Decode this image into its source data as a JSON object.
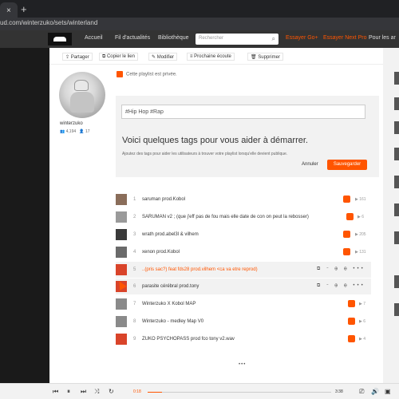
{
  "browser": {
    "tab_close": "×",
    "new_tab": "+",
    "url": "ud.com/winterzuko/sets/winterland"
  },
  "header": {
    "nav": [
      "Accueil",
      "Fil d'actualités",
      "Bibliothèque"
    ],
    "search_placeholder": "Rechercher",
    "try_go": "Essayer Go+",
    "try_pro": "Essayer Next Pro",
    "for_artists": "Pour les ar"
  },
  "actions": [
    "Partager",
    "Copier le lien",
    "Modifier",
    "Prochaine écoute",
    "Supprimer"
  ],
  "profile": {
    "username": "winterzuko",
    "followers": "4,194",
    "following": "17"
  },
  "playlist": {
    "private_notice": "Cette playlist est privée."
  },
  "tags": {
    "input_value": "#Hip Hop  #Rap",
    "heading": "Voici quelques tags pour vous aider à démarrer.",
    "subtext": "Ajoutez des tags pour aider les utilisateurs à trouver votre playlist lorsqu'elle devient publique.",
    "cancel_label": "Annuler",
    "save_label": "Sauvegarder"
  },
  "tracks": [
    {
      "num": "1",
      "title": "saruman prod.Kobol",
      "plays": "▶ 161"
    },
    {
      "num": "2",
      "title": "SARUMAN v2 ; (que j'eff pas de fou mais elle date de con on peut la rebosser)",
      "plays": "▶ 6"
    },
    {
      "num": "3",
      "title": "wrath prod.abel3l & vilhem",
      "plays": "▶ 205"
    },
    {
      "num": "4",
      "title": "xenon prod.Kobol",
      "plays": "▶ 131"
    },
    {
      "num": "5",
      "title": "..(pris sac?) feat fds28 prod.vilhem <ca va etre reprod)",
      "plays": ""
    },
    {
      "num": "6",
      "title": "parasite cérébral prod.tony",
      "plays": ""
    },
    {
      "num": "7",
      "title": "Winterzuko X Kobol MAP",
      "plays": "▶ 7"
    },
    {
      "num": "8",
      "title": "Winterzuko - medley Map V0",
      "plays": "▶ 6"
    },
    {
      "num": "9",
      "title": "ZUKO PSYCHOPASS prod fco tony v2.wav",
      "plays": "▶ 4"
    }
  ],
  "track_hover_icons": "⧉ ⌁ ⊕ ⊕ •••",
  "loader": "•••",
  "player": {
    "elapsed": "0:18",
    "duration": "3:38",
    "progress": 0.08
  },
  "colors": {
    "accent": "#ff5500"
  }
}
